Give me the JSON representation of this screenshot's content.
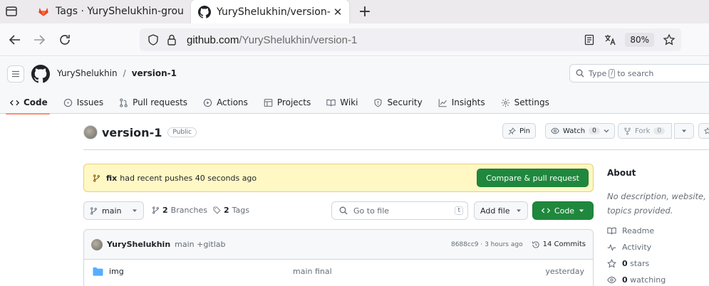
{
  "browser": {
    "tabs": [
      {
        "title": "Tags · YuryShelukhin-grou",
        "active": false
      },
      {
        "title": "YuryShelukhin/version-1",
        "active": true
      }
    ],
    "url_host": "github.com",
    "url_path": "/YuryShelukhin/version-1",
    "zoom": "80%"
  },
  "header": {
    "owner": "YuryShelukhin",
    "separator": "/",
    "repo": "version-1",
    "search_prefix": "Type",
    "search_key": "/",
    "search_suffix": "to search"
  },
  "repo_nav": [
    {
      "label": "Code",
      "icon": "code-icon"
    },
    {
      "label": "Issues",
      "icon": "issue-icon"
    },
    {
      "label": "Pull requests",
      "icon": "pull-request-icon"
    },
    {
      "label": "Actions",
      "icon": "play-icon"
    },
    {
      "label": "Projects",
      "icon": "table-icon"
    },
    {
      "label": "Wiki",
      "icon": "book-icon"
    },
    {
      "label": "Security",
      "icon": "shield-icon"
    },
    {
      "label": "Insights",
      "icon": "graph-icon"
    },
    {
      "label": "Settings",
      "icon": "gear-icon"
    }
  ],
  "repo_title": {
    "name": "version-1",
    "visibility": "Public",
    "pin": "Pin",
    "watch": "Watch",
    "watch_count": "0",
    "fork": "Fork",
    "fork_count": "0"
  },
  "banner": {
    "branch": "fix",
    "text": "had recent pushes 40 seconds ago",
    "button": "Compare & pull request"
  },
  "toolbar": {
    "branch": "main",
    "branches_count": "2",
    "branches_label": "Branches",
    "tags_count": "2",
    "tags_label": "Tags",
    "goto_placeholder": "Go to file",
    "goto_key": "t",
    "add_file": "Add file",
    "code": "Code"
  },
  "latest_commit": {
    "author": "YuryShelukhin",
    "message": "main +gitlab",
    "meta": "8688cc9 · 3 hours ago",
    "commits": "14 Commits"
  },
  "files": [
    {
      "name": "img",
      "message": "main final",
      "date": "yesterday",
      "icon": "folder-icon"
    }
  ],
  "about": {
    "heading": "About",
    "description": "No description, website, or topics provided.",
    "links": [
      {
        "icon": "book-icon",
        "label": "Readme"
      },
      {
        "icon": "pulse-icon",
        "label": "Activity"
      },
      {
        "icon": "star-icon",
        "count": "0",
        "label": "stars"
      },
      {
        "icon": "eye-icon",
        "count": "0",
        "label": "watching"
      }
    ]
  },
  "colors": {
    "primary_green": "#1f883d",
    "banner_yellow": "#fff8c5",
    "tab_underline": "#fd8c73"
  }
}
